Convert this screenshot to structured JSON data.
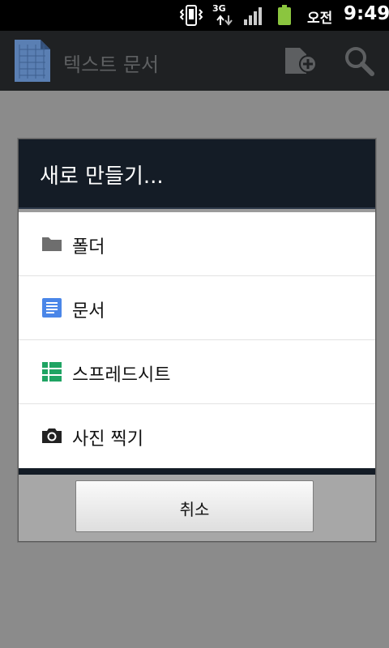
{
  "status_bar": {
    "network": "3G",
    "ampm": "오전",
    "time": "9:49",
    "icons": [
      "vibrate-icon",
      "network-3g-icon",
      "signal-icon",
      "battery-icon"
    ]
  },
  "action_bar": {
    "title": "텍스트 문서",
    "icons": [
      "docs-logo-icon",
      "new-document-icon",
      "search-icon"
    ]
  },
  "dialog": {
    "title": "새로 만들기...",
    "items": [
      {
        "label": "폴더",
        "icon": "folder-icon"
      },
      {
        "label": "문서",
        "icon": "document-icon"
      },
      {
        "label": "스프레드시트",
        "icon": "spreadsheet-icon"
      },
      {
        "label": "사진 찍기",
        "icon": "camera-icon"
      }
    ],
    "cancel_label": "취소"
  },
  "colors": {
    "dialog_header": "#141c26",
    "actionbar": "#1f2123",
    "document_icon": "#4a86e8",
    "spreadsheet_icon": "#1fa463",
    "battery": "#8bc53f"
  }
}
